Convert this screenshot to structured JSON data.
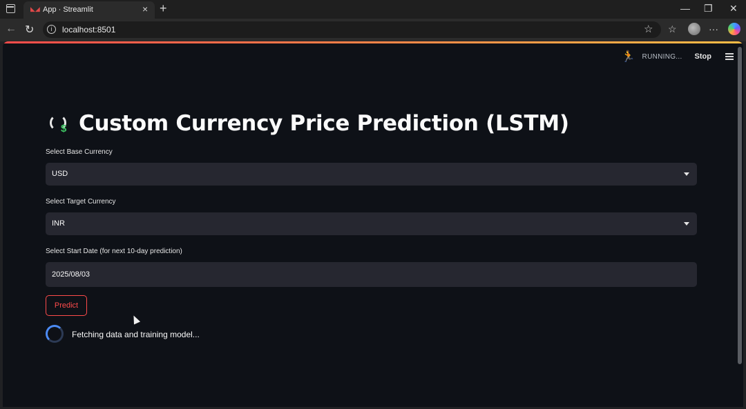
{
  "browser": {
    "tab_title": "App · Streamlit",
    "url": "localhost:8501",
    "window_controls": [
      "minimize-icon",
      "restore-icon",
      "close-icon"
    ]
  },
  "app_header": {
    "running_label": "RUNNING...",
    "stop_label": "Stop"
  },
  "main": {
    "title": "Custom Currency Price Prediction (LSTM)",
    "title_icon": "currency-exchange-icon",
    "base_currency": {
      "label": "Select Base Currency",
      "value": "USD"
    },
    "target_currency": {
      "label": "Select Target Currency",
      "value": "INR"
    },
    "start_date": {
      "label": "Select Start Date (for next 10-day prediction)",
      "value": "2025/08/03"
    },
    "predict_label": "Predict",
    "spinner_text": "Fetching data and training model..."
  },
  "colors": {
    "background": "#0e1117",
    "input_bg": "#262730",
    "accent": "#ff4b4b",
    "spinner": "#4c8bf5"
  }
}
